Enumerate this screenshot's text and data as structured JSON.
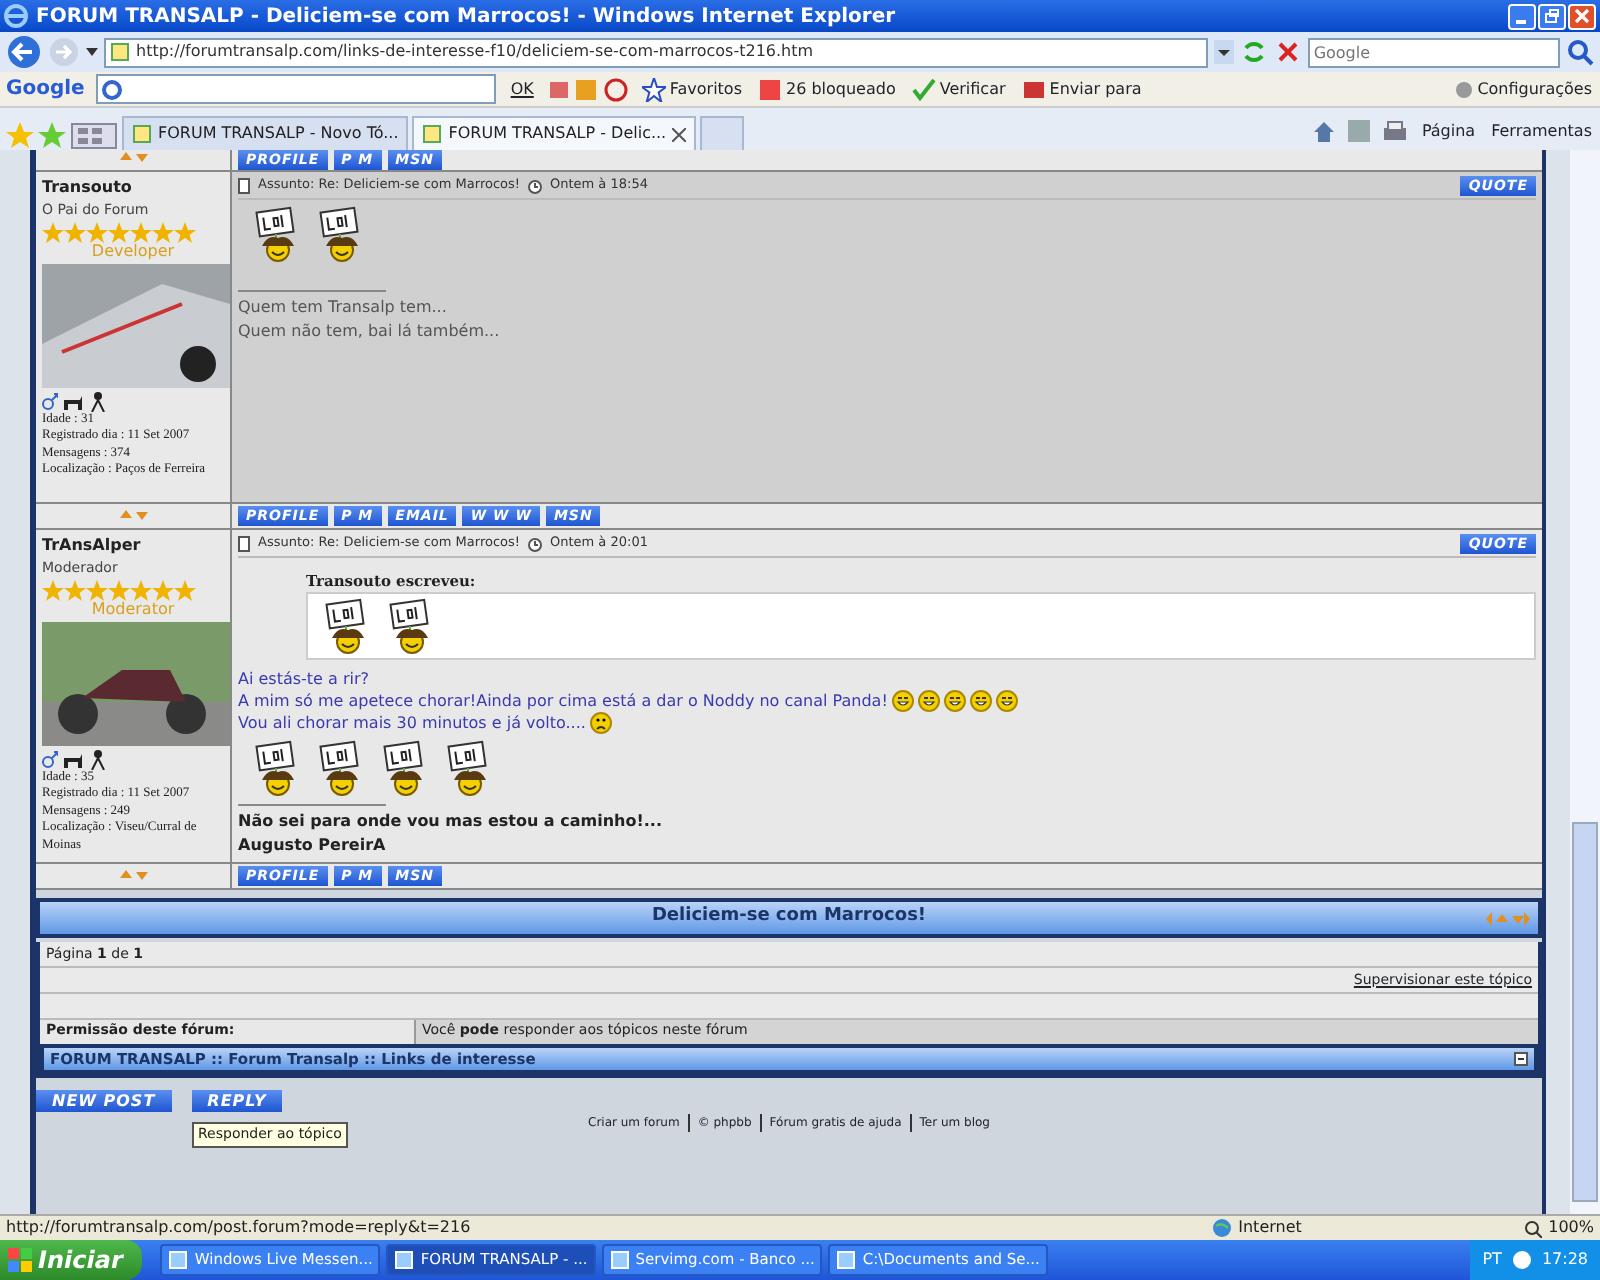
{
  "window": {
    "title": "FORUM TRANSALP - Deliciem-se com Marrocos! - Windows Internet Explorer"
  },
  "address_bar": {
    "url": "http://forumtransalp.com/links-de-interesse-f10/deliciem-se-com-marrocos-t216.htm",
    "search_placeholder": "Google"
  },
  "google_toolbar": {
    "logo": "Google",
    "button": "OK",
    "items": [
      "Favoritos",
      "26 bloqueado",
      "Verificar",
      "Enviar para"
    ],
    "settings": "Configurações"
  },
  "tabs": [
    {
      "label": "FORUM TRANSALP - Novo Tó...",
      "selected": false
    },
    {
      "label": "FORUM TRANSALP - Delic...",
      "selected": true
    }
  ],
  "command_bar": {
    "items": [
      "Página",
      "Ferramentas"
    ]
  },
  "forum": {
    "top_buttons": [
      "PROFILE",
      "P M",
      "MSN"
    ],
    "posts": [
      {
        "author": "Transouto",
        "rank": "O Pai do Forum",
        "stars": 7,
        "rank_label": "Developer",
        "details": [
          "Idade : 31",
          "Registrado dia : 11 Set 2007",
          "Mensagens : 374",
          "Localização : Paços de Ferreira"
        ],
        "subject": "Assunto: Re: Deliciem-se com Marrocos!",
        "time": "Ontem à 18:54",
        "quote_button": "QUOTE",
        "body": [
          {
            "kind": "smileys",
            "items": [
              {
                "kind": "lol"
              },
              {
                "kind": "lol"
              }
            ]
          }
        ],
        "signature_bold": false,
        "signature": [
          "Quem tem Transalp tem...",
          "Quem não tem, bai lá também..."
        ],
        "buttons": [
          "PROFILE",
          "P M",
          "EMAIL",
          "W W W",
          "MSN"
        ]
      },
      {
        "author": "TrAnsAlper",
        "rank": "Moderador",
        "stars": 7,
        "rank_label": "Moderator",
        "details": [
          "Idade : 35",
          "Registrado dia : 11 Set 2007",
          "Mensagens : 249",
          "Localização : Viseu/Curral de Moinas"
        ],
        "subject": "Assunto: Re: Deliciem-se com Marrocos!",
        "time": "Ontem à 20:01",
        "quote_button": "QUOTE",
        "body": [
          {
            "kind": "quote",
            "author": "Transouto escreveu:",
            "items": [
              {
                "kind": "lol"
              },
              {
                "kind": "lol"
              }
            ]
          },
          {
            "kind": "text",
            "text": "Ai estás-te a rir?"
          },
          {
            "kind": "text",
            "text": "A mim só me apetece chorar!Ainda por cima está a dar o Noddy no canal Panda!",
            "smileys": [
              {
                "kind": "grin"
              },
              {
                "kind": "grin"
              },
              {
                "kind": "grin"
              },
              {
                "kind": "grin"
              },
              {
                "kind": "grin"
              }
            ]
          },
          {
            "kind": "text",
            "text": "Vou ali chorar mais 30 minutos e já volto....",
            "smileys": [
              {
                "kind": "sad"
              }
            ]
          },
          {
            "kind": "smileys",
            "items": [
              {
                "kind": "lol"
              },
              {
                "kind": "lol"
              },
              {
                "kind": "lol"
              },
              {
                "kind": "lol"
              }
            ]
          }
        ],
        "signature_bold": true,
        "signature": [
          "Não sei para onde vou mas estou a caminho!...",
          "Augusto PereirA"
        ],
        "buttons": [
          "PROFILE",
          "P M",
          "MSN"
        ]
      }
    ],
    "topic_title": "Deliciem-se com Marrocos!",
    "pagination": "Página **1** de **1**",
    "watch_link": "Supervisionar este tópico",
    "permission_label": "Permissão deste fórum:",
    "permission_text": "Você **pode** responder aos tópicos neste fórum",
    "breadcrumb": "FORUM TRANSALP :: Forum Transalp :: Links de interesse",
    "action_buttons": [
      "NEW POST",
      "REPLY"
    ],
    "tooltip": "Responder ao tópico",
    "footer_links": [
      "Criar um forum",
      "© phpbb",
      "Fórum gratis de ajuda",
      "Ter um blog"
    ]
  },
  "status_bar": {
    "url": "http://forumtransalp.com/post.forum?mode=reply&t=216",
    "zone": "Internet",
    "zoom": "100%"
  },
  "taskbar": {
    "start": "Iniciar",
    "tasks": [
      {
        "label": "Windows Live Messen...",
        "selected": false
      },
      {
        "label": "FORUM TRANSALP - ...",
        "selected": true
      },
      {
        "label": "Servimg.com - Banco ...",
        "selected": false
      },
      {
        "label": "C:\\Documents and Se...",
        "selected": false
      }
    ],
    "language": "PT",
    "clock": "17:28"
  }
}
